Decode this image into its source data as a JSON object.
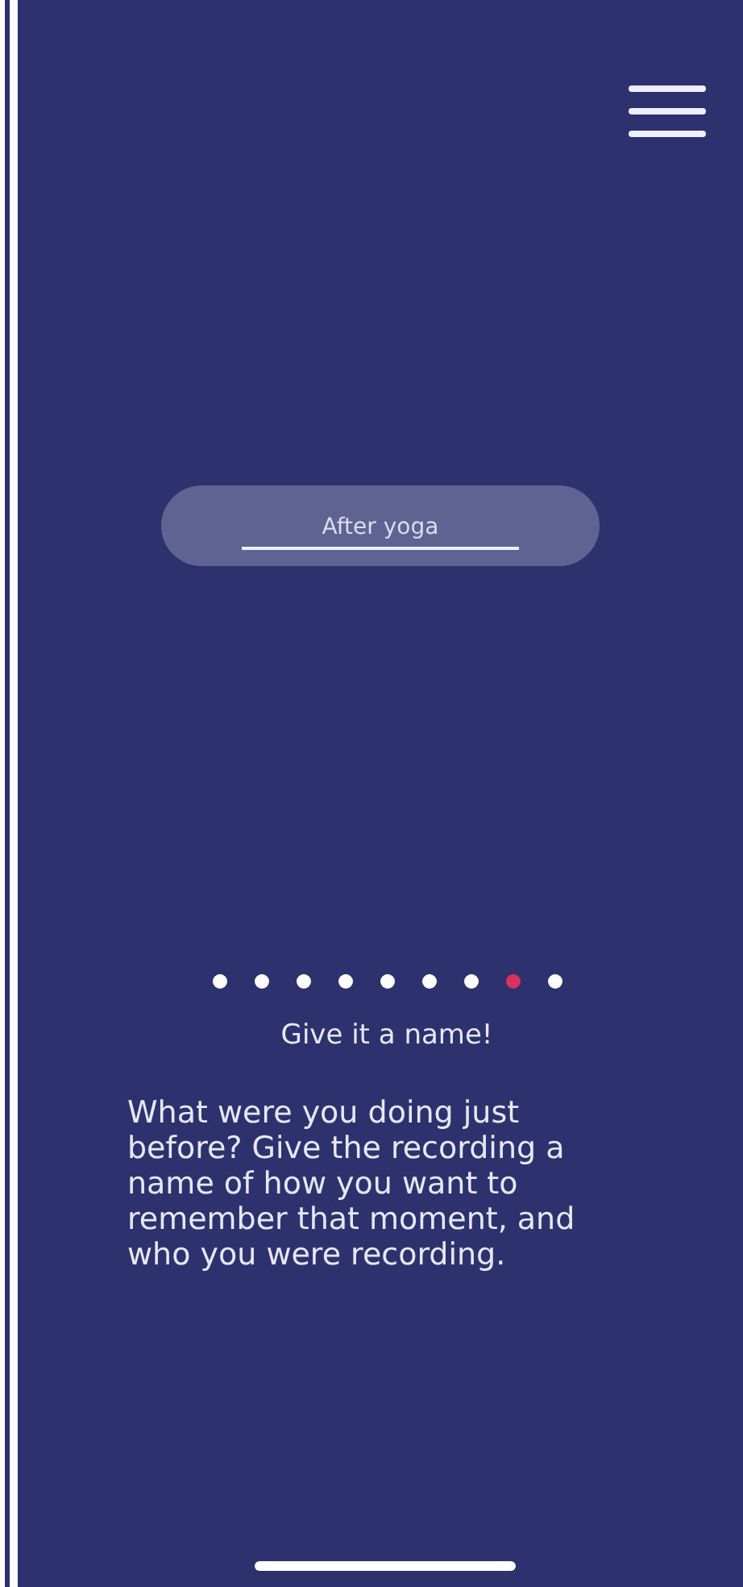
{
  "name_field": {
    "value": "After yoga"
  },
  "pager_dots": [
    {
      "selected": false
    },
    {
      "selected": false
    },
    {
      "selected": false
    },
    {
      "selected": false
    },
    {
      "selected": false
    },
    {
      "selected": false
    },
    {
      "selected": false
    },
    {
      "selected": true
    },
    {
      "selected": false
    }
  ],
  "title": "Give it a name!",
  "description": "What were you doing just before? Give the recording a name of how you want to remember that moment, and who you were recording."
}
